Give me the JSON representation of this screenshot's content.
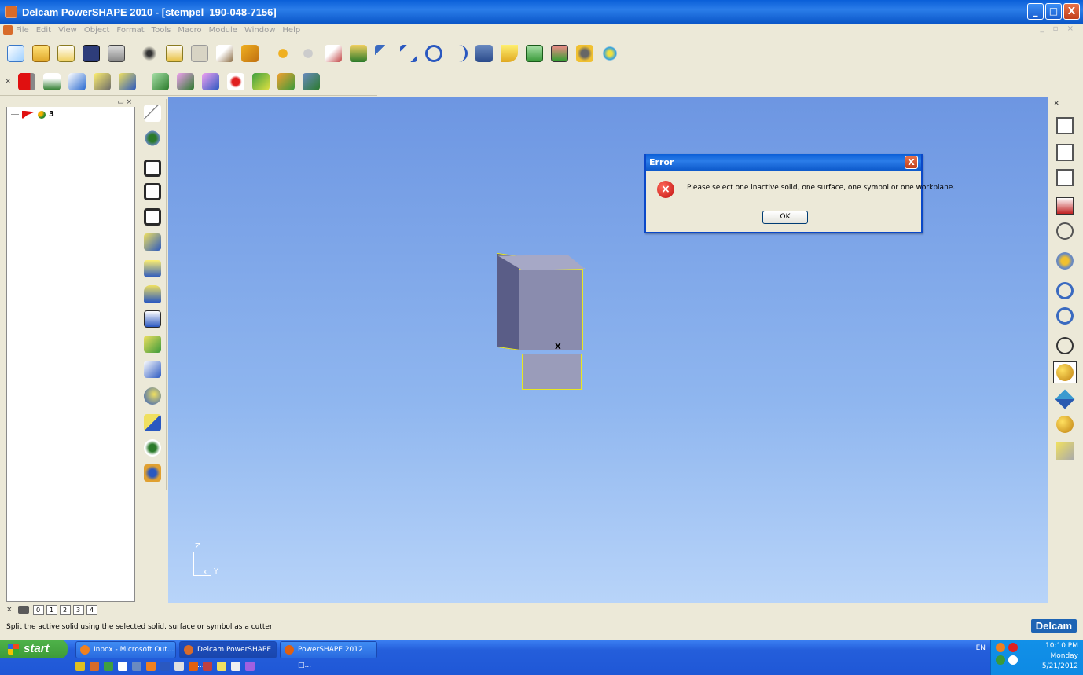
{
  "window": {
    "title": "Delcam PowerSHAPE 2010 - [stempel_190-048-7156]",
    "minimize": "_",
    "maximize": "□",
    "close": "X"
  },
  "menu": [
    "File",
    "Edit",
    "View",
    "Object",
    "Format",
    "Tools",
    "Macro",
    "Module",
    "Window",
    "Help"
  ],
  "tree": {
    "item_label": "3"
  },
  "dialog": {
    "title": "Error",
    "message": "Please select one inactive solid, one surface, one symbol or one workplane.",
    "ok_label": "OK",
    "close_label": "X"
  },
  "model": {
    "marker": "X"
  },
  "axis": {
    "z": "Z",
    "y": "Y",
    "x": "X"
  },
  "tabs": [
    "0",
    "1",
    "2",
    "3",
    "4"
  ],
  "status": {
    "message": "Split the active solid using the selected solid, surface or symbol as a cutter",
    "logo": "Delcam"
  },
  "taskbar": {
    "start": "start",
    "tasks": [
      "Inbox - Microsoft Out...",
      "Delcam PowerSHAPE ...",
      "PowerSHAPE 2012 □..."
    ],
    "language": "EN",
    "time": "10:10 PM",
    "day": "Monday",
    "date": "5/21/2012"
  },
  "colors": {
    "viewport_top": "#6d96e2",
    "viewport_bottom": "#b8d4f9",
    "selection": "#e8e820",
    "xp_blue": "#245edb"
  }
}
